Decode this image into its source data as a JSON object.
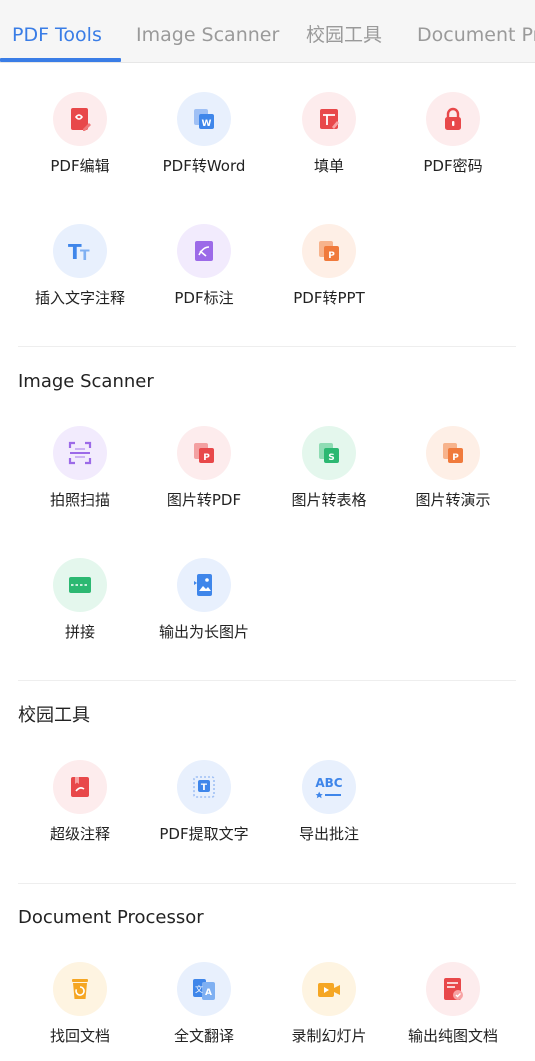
{
  "tabs": [
    {
      "label": "PDF Tools"
    },
    {
      "label": "Image Scanner"
    },
    {
      "label": "校园工具"
    },
    {
      "label": "Document Pr"
    }
  ],
  "sections": [
    {
      "title": "",
      "items": [
        {
          "label": "PDF编辑",
          "icon": "pdf-edit-icon"
        },
        {
          "label": "PDF转Word",
          "icon": "pdf-to-word-icon"
        },
        {
          "label": "填单",
          "icon": "fill-form-icon"
        },
        {
          "label": "PDF密码",
          "icon": "lock-icon"
        },
        {
          "label": "插入文字注释",
          "icon": "text-annotation-icon"
        },
        {
          "label": "PDF标注",
          "icon": "pdf-markup-icon"
        },
        {
          "label": "PDF转PPT",
          "icon": "pdf-to-ppt-icon"
        }
      ]
    },
    {
      "title": "Image Scanner",
      "items": [
        {
          "label": "拍照扫描",
          "icon": "photo-scan-icon"
        },
        {
          "label": "图片转PDF",
          "icon": "image-to-pdf-icon"
        },
        {
          "label": "图片转表格",
          "icon": "image-to-sheet-icon"
        },
        {
          "label": "图片转演示",
          "icon": "image-to-slides-icon"
        },
        {
          "label": "拼接",
          "icon": "stitch-icon"
        },
        {
          "label": "输出为长图片",
          "icon": "long-image-icon"
        }
      ]
    },
    {
      "title": "校园工具",
      "items": [
        {
          "label": "超级注释",
          "icon": "super-annotation-icon"
        },
        {
          "label": "PDF提取文字",
          "icon": "extract-text-icon"
        },
        {
          "label": "导出批注",
          "icon": "export-comments-icon"
        }
      ]
    },
    {
      "title": "Document Processor",
      "items": [
        {
          "label": "找回文档",
          "icon": "recover-document-icon"
        },
        {
          "label": "全文翻译",
          "icon": "translate-icon"
        },
        {
          "label": "录制幻灯片",
          "icon": "record-slides-icon"
        },
        {
          "label": "输出纯图文档",
          "icon": "image-only-document-icon"
        }
      ]
    }
  ],
  "colors": {
    "accent": "#3a7de6",
    "red": "#e8484a",
    "blue": "#3f86ea",
    "purple": "#9c6ae8",
    "orange": "#f07a3c",
    "green": "#2cb872",
    "yellow": "#f5a623"
  }
}
